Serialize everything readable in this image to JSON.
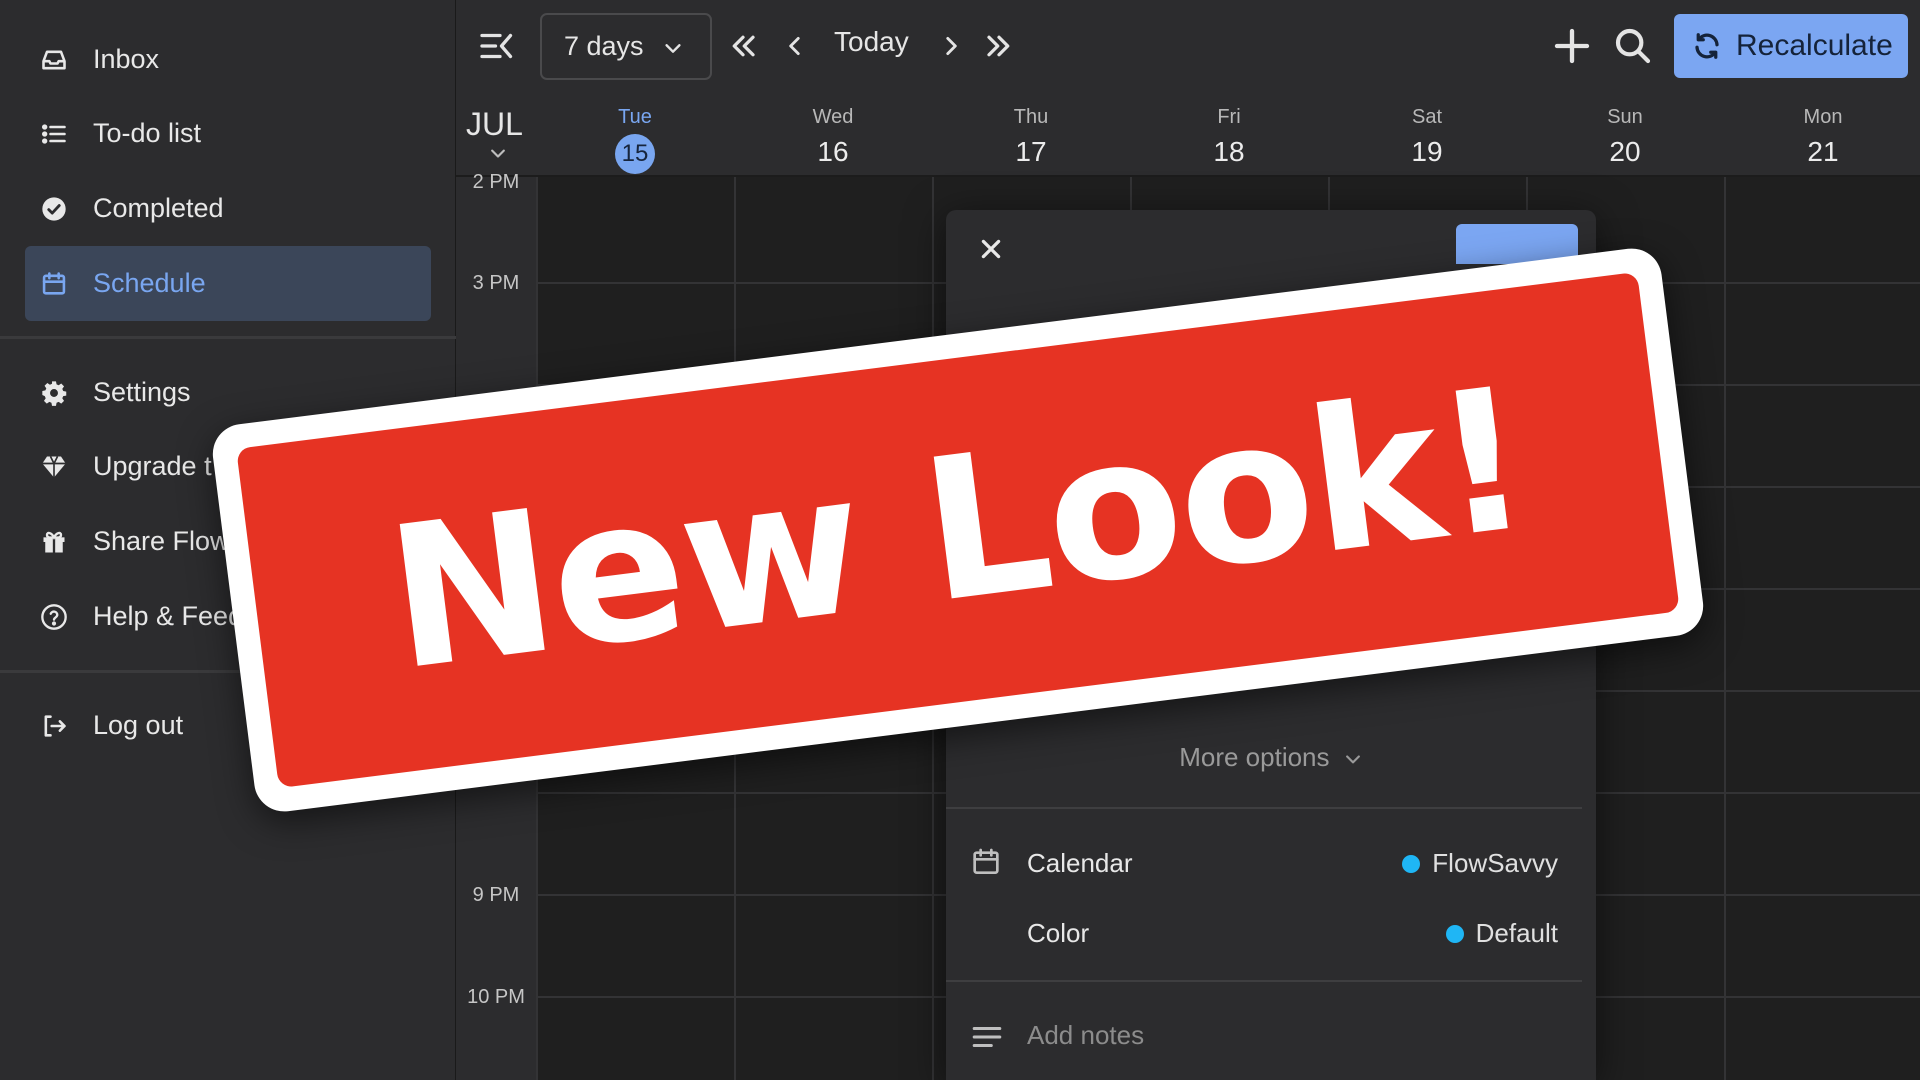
{
  "sidebar": {
    "items": [
      {
        "label": "Inbox",
        "icon": "inbox-icon"
      },
      {
        "label": "To-do list",
        "icon": "list-icon"
      },
      {
        "label": "Completed",
        "icon": "check-circle-icon"
      },
      {
        "label": "Schedule",
        "icon": "calendar-icon",
        "active": true
      },
      {
        "label": "Settings",
        "icon": "gear-icon"
      },
      {
        "label": "Upgrade t",
        "icon": "diamond-icon"
      },
      {
        "label": "Share Flow",
        "icon": "gift-icon"
      },
      {
        "label": "Help & Feed",
        "icon": "help-circle-icon"
      },
      {
        "label": "Log out",
        "icon": "logout-icon"
      }
    ]
  },
  "toolbar": {
    "range_label": "7 days",
    "today_label": "Today",
    "recalculate_label": "Recalculate"
  },
  "calendar": {
    "month": "JUL",
    "days": [
      {
        "name": "Tue",
        "num": "15",
        "current": true
      },
      {
        "name": "Wed",
        "num": "16"
      },
      {
        "name": "Thu",
        "num": "17"
      },
      {
        "name": "Fri",
        "num": "18"
      },
      {
        "name": "Sat",
        "num": "19"
      },
      {
        "name": "Sun",
        "num": "20"
      },
      {
        "name": "Mon",
        "num": "21"
      }
    ],
    "times": [
      "2 PM",
      "3 PM",
      "9 PM",
      "10 PM"
    ]
  },
  "panel": {
    "more_options": "More options",
    "calendar_label": "Calendar",
    "calendar_value": "FlowSavvy",
    "color_label": "Color",
    "color_value": "Default",
    "notes_placeholder": "Add notes",
    "dot_color": "#1fb6f5"
  },
  "overlay": {
    "headline": "New Look!",
    "background_color": "#e63323"
  },
  "colors": {
    "accent": "#7ba6f2",
    "sidebar_bg": "#2c2c2e",
    "grid_bg": "#1f1f1f"
  }
}
